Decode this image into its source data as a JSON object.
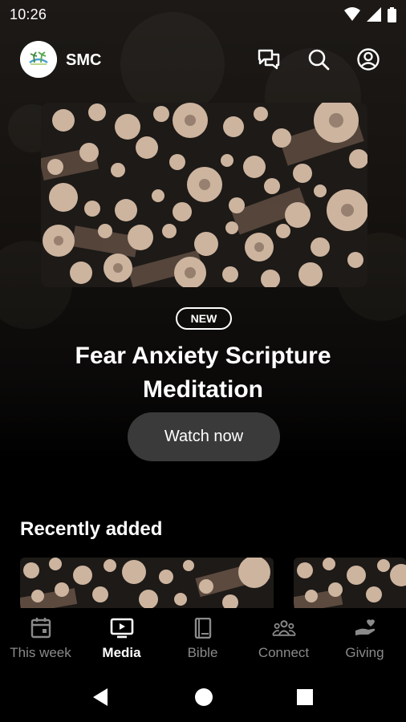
{
  "status_bar": {
    "time": "10:26",
    "icons": [
      "wifi-icon",
      "cellular-signal-icon",
      "battery-icon"
    ]
  },
  "header": {
    "org_name": "SMC",
    "actions": [
      "chat-icon",
      "search-icon",
      "account-icon"
    ]
  },
  "hero": {
    "badge": "NEW",
    "title": "Fear Anxiety Scripture Meditation",
    "button_label": "Watch now",
    "image": "stacked-log-ends-photo"
  },
  "recently_added": {
    "title": "Recently added"
  },
  "bottom_nav": {
    "items": [
      {
        "label": "This week",
        "icon": "calendar-icon",
        "active": false
      },
      {
        "label": "Media",
        "icon": "tv-play-icon",
        "active": true
      },
      {
        "label": "Bible",
        "icon": "book-icon",
        "active": false
      },
      {
        "label": "Connect",
        "icon": "people-group-icon",
        "active": false
      },
      {
        "label": "Giving",
        "icon": "hand-heart-icon",
        "active": false
      }
    ]
  },
  "system_nav": [
    "back-icon",
    "home-icon",
    "recents-icon"
  ],
  "colors": {
    "background": "#000000",
    "active": "#ffffff",
    "inactive": "#8a8a8a",
    "button": "#3a3a3a"
  }
}
